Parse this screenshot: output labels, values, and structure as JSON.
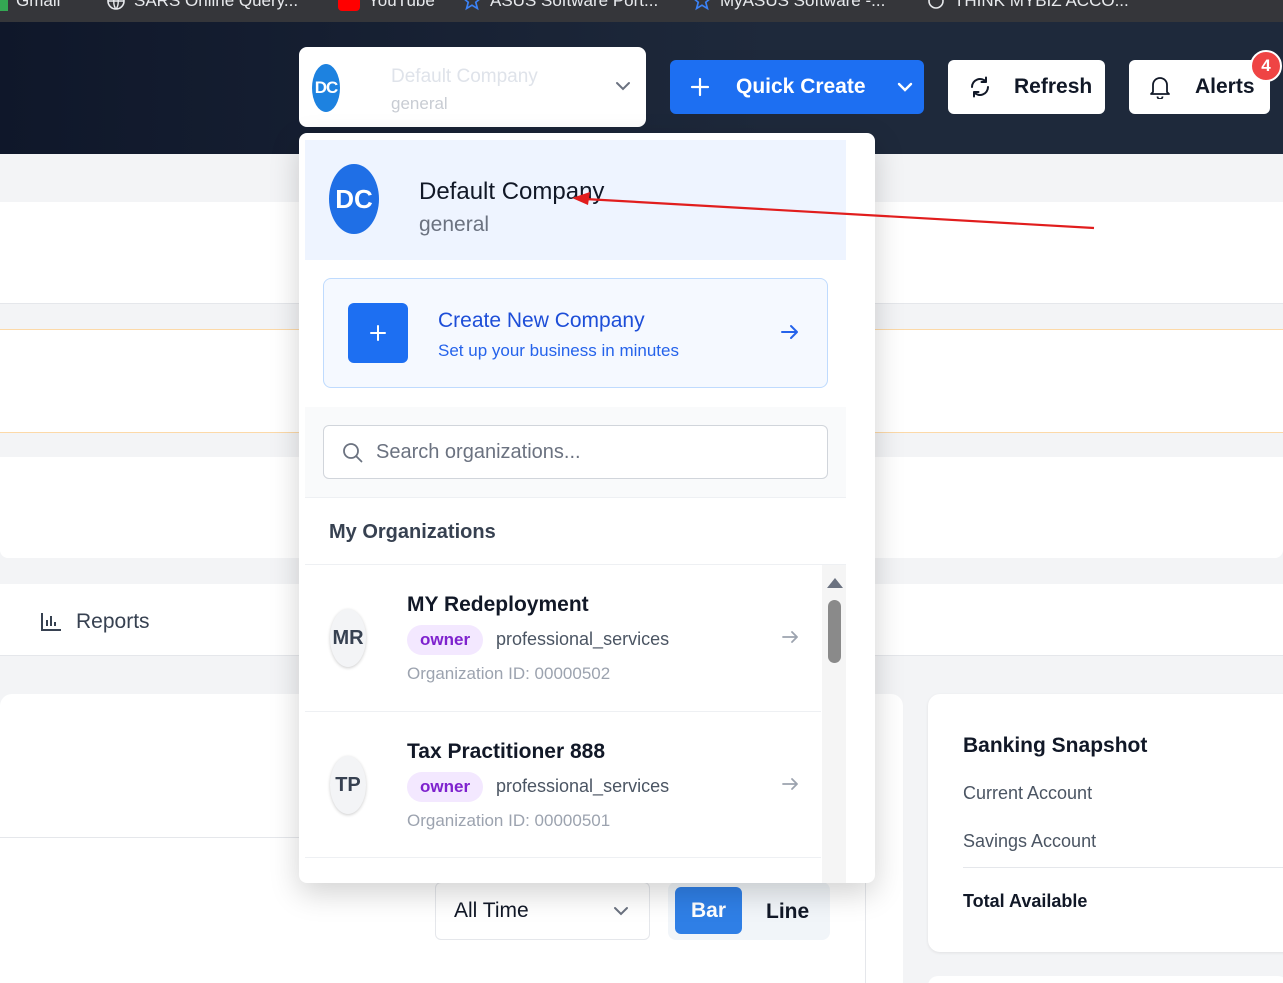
{
  "bookmarks": [
    {
      "label": "Gmail",
      "icon": "gmail-icon"
    },
    {
      "label": "SARS Online Query...",
      "icon": "globe-icon"
    },
    {
      "label": "YouTube",
      "icon": "youtube-icon"
    },
    {
      "label": "ASUS Software Port...",
      "icon": "star-icon"
    },
    {
      "label": "MyASUS Software -...",
      "icon": "star-icon"
    },
    {
      "label": "THINK MYBIZ ACCO...",
      "icon": "openai-icon"
    }
  ],
  "header": {
    "company_selector": {
      "initials": "DC",
      "name": "Default Company",
      "subtitle": "general"
    },
    "quick_create_label": "Quick Create",
    "refresh_label": "Refresh",
    "alerts_label": "Alerts",
    "alerts_count": "4"
  },
  "dropdown": {
    "current": {
      "initials": "DC",
      "name": "Default Company",
      "subtitle": "general"
    },
    "create": {
      "title": "Create New Company",
      "subtitle": "Set up your business in minutes"
    },
    "search_placeholder": "Search organizations...",
    "section_title": "My Organizations",
    "organizations": [
      {
        "initials": "MR",
        "name": "MY Redeployment",
        "role": "owner",
        "industry": "professional_services",
        "org_id": "Organization ID: 00000502"
      },
      {
        "initials": "TP",
        "name": "Tax Practitioner 888",
        "role": "owner",
        "industry": "professional_services",
        "org_id": "Organization ID: 00000501"
      }
    ]
  },
  "background": {
    "reports_label": "Reports",
    "banking": {
      "title": "Banking Snapshot",
      "current": "Current Account",
      "savings": "Savings Account",
      "total": "Total Available"
    },
    "period": "All Time",
    "chart_type_options": [
      "Bar",
      "Line"
    ],
    "chart_type_selected": "Bar"
  },
  "colors": {
    "accent": "#1d6ff2",
    "header_bg": "#1e293b",
    "alert_badge": "#ef4444",
    "annotation_arrow": "#e11d1d"
  }
}
